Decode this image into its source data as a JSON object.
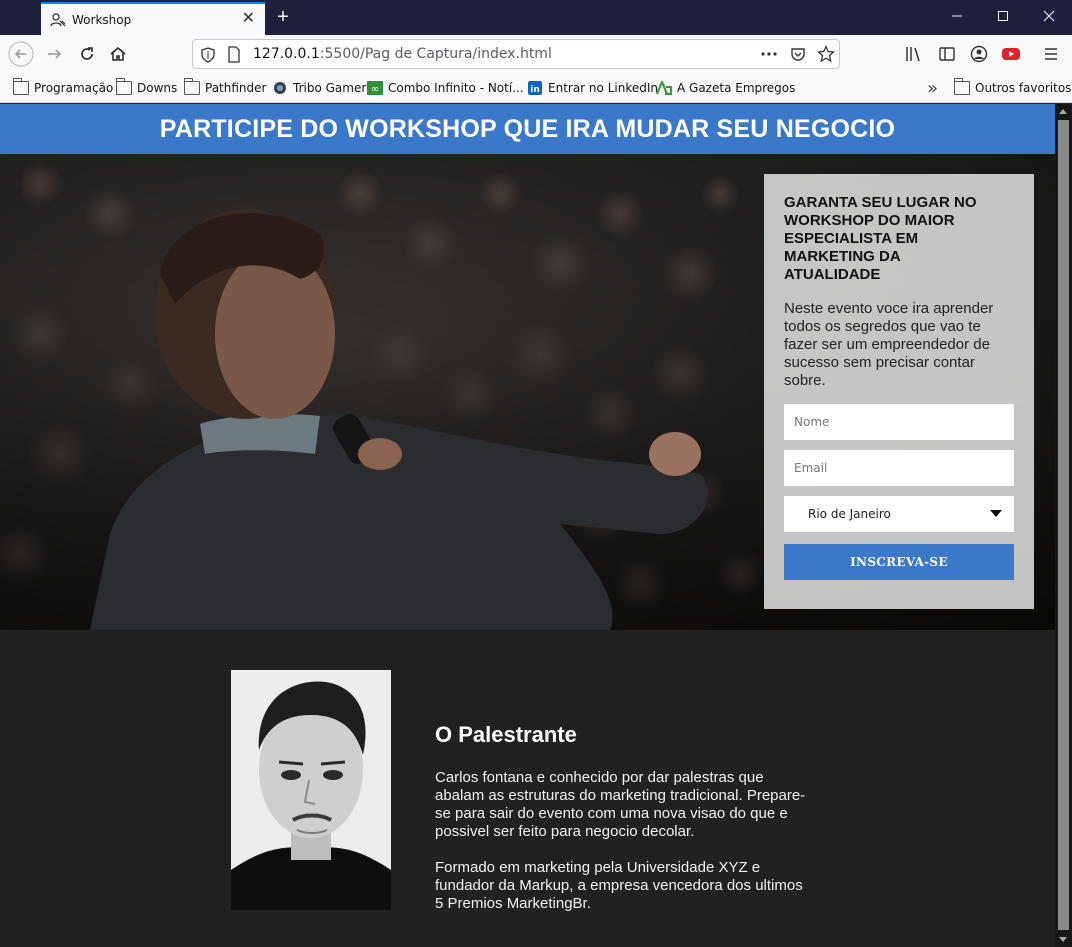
{
  "browser": {
    "tab_title": "Workshop",
    "new_tab_symbol": "+",
    "url_host": "127.0.0.1",
    "url_rest": ":5500/Pag de Captura/index.html",
    "icons": [
      "back-icon",
      "forward-icon",
      "reload-icon",
      "home-icon",
      "shield-icon",
      "page-icon",
      "more-icon",
      "pocket-icon",
      "star-icon",
      "library-icon",
      "sidebar-icon",
      "account-icon",
      "extension-icon",
      "menu-icon"
    ]
  },
  "bookmarks": {
    "items": [
      {
        "label": "Programação"
      },
      {
        "label": "Downs"
      },
      {
        "label": "Pathfinder"
      },
      {
        "label": "Tribo Gamer"
      },
      {
        "label": "Combo Infinito - Notí..."
      },
      {
        "label": "Entrar no LinkedIn"
      },
      {
        "label": "A Gazeta Empregos"
      }
    ],
    "overflow": "»",
    "other": "Outros favoritos"
  },
  "page": {
    "header_title": "PARTICIPE DO WORKSHOP QUE IRA MUDAR SEU NEGOCIO",
    "form": {
      "heading": "GARANTA SEU LUGAR NO WORKSHOP DO MAIOR ESPECIALISTA EM MARKETING DA ATUALIDADE",
      "description": "Neste evento voce ira aprender todos os segredos que vao te fazer ser um empreendedor de sucesso sem precisar contar sobre.",
      "name_placeholder": "Nome",
      "email_placeholder": "Email",
      "city_selected": "Rio de Janeiro",
      "submit_label": "INSCREVA-SE"
    },
    "speaker": {
      "title": "O Palestrante",
      "paragraph1": "Carlos fontana e conhecido por dar palestras que abalam as estruturas do marketing tradicional. Prepare-se para sair do evento com uma nova visao do que e possivel ser feito para negocio decolar.",
      "paragraph2": "Formado em marketing pela Universidade XYZ e fundador da Markup, a empresa vencedora dos ultimos 5 Premios MarketingBr."
    }
  },
  "colors": {
    "accent": "#3a78c9",
    "dark_bg": "#212121"
  }
}
